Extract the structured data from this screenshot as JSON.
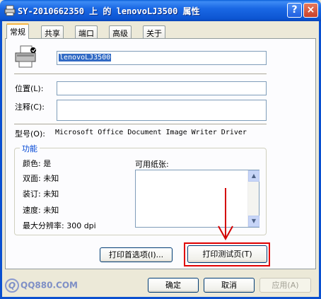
{
  "window": {
    "title": "SY-2010662350 上 的 lenovoLJ3500 属性",
    "help_label": "?",
    "close_label": "×"
  },
  "tabs": [
    {
      "label": "常规",
      "active": true
    },
    {
      "label": "共享",
      "active": false
    },
    {
      "label": "端口",
      "active": false
    },
    {
      "label": "高级",
      "active": false
    },
    {
      "label": "关于",
      "active": false
    }
  ],
  "general": {
    "printer_name": "lenovoLJ3500",
    "location_label": "位置(L):",
    "location_value": "",
    "comment_label": "注释(C):",
    "comment_value": "",
    "model_label": "型号(O):",
    "model_value": "Microsoft Office Document Image Writer Driver"
  },
  "features": {
    "title": "功能",
    "color": "颜色: 是",
    "duplex": "双面: 未知",
    "staple": "装订: 未知",
    "speed": "速度: 未知",
    "max_resolution": "最大分辨率: 300 dpi",
    "paper_label": "可用纸张:",
    "papers": []
  },
  "buttons": {
    "preferences": "打印首选项(I)...",
    "test_page": "打印测试页(T)",
    "ok": "确定",
    "cancel": "取消",
    "apply": "应用(A)"
  },
  "watermark": {
    "symbol": "Q",
    "text": "QQ880.COM"
  },
  "colors": {
    "titlebar": "#0a5fd8",
    "highlight": "#e00000",
    "group_title": "#0046d5"
  }
}
